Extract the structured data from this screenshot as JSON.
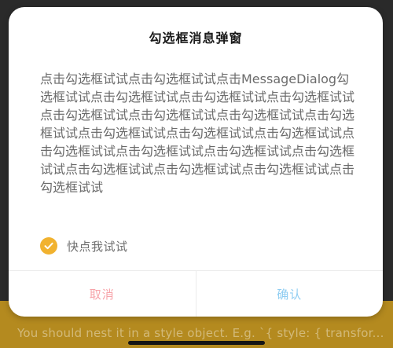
{
  "dialog": {
    "title": "勾选框消息弹窗",
    "message": "点击勾选框试试点击勾选框试试点击MessageDialog勾选框试试点击勾选框试试点击勾选框试试点击勾选框试试点击勾选框试试点击勾选框试试点击勾选框试试点击勾选框试试点击勾选框试试点击勾选框试试点击勾选框试试点击勾选框试试点击勾选框试试点击勾选框试试点击勾选框试试点击勾选框试试点击勾选框试试点击勾选框试试点击勾选框试试",
    "checkbox": {
      "label": "快点我试试",
      "checked": true,
      "color": "#f1b22f"
    },
    "buttons": {
      "cancel": {
        "label": "取消",
        "color": "#f7a3a9"
      },
      "confirm": {
        "label": "确认",
        "color": "#8fcdf2"
      }
    }
  },
  "background": {
    "error_text": "You should nest it in a style object. E.g. `{ style: { transfor...",
    "strip_color": "#b48a1f"
  },
  "icons": {
    "check": "check-icon"
  }
}
